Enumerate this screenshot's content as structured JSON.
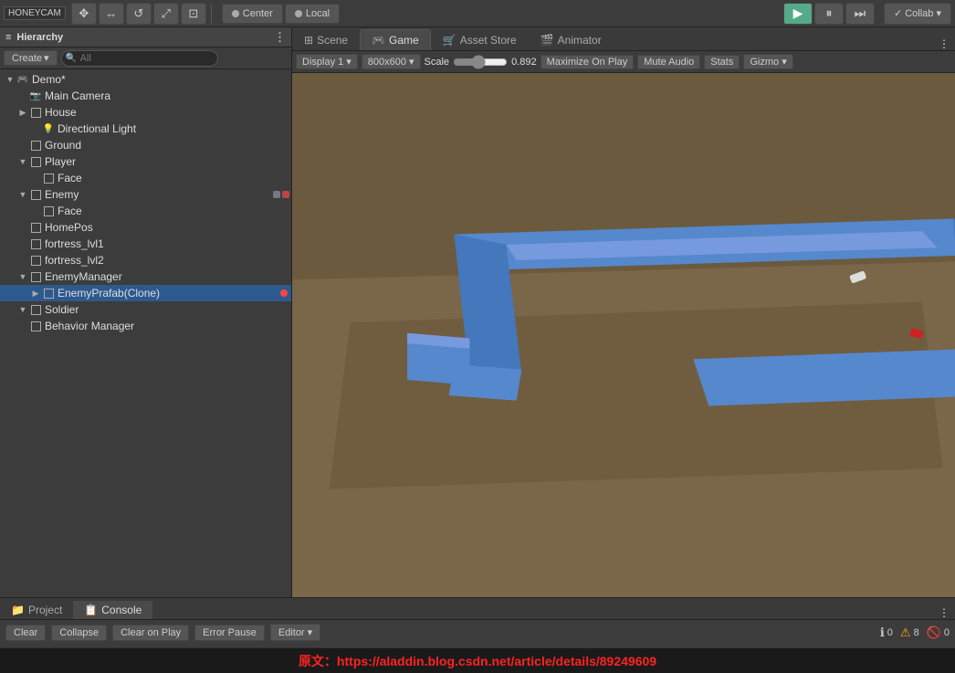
{
  "toolbar": {
    "tools": [
      "✥",
      "↔",
      "↺",
      "⤢",
      "⊡"
    ],
    "pivot": "Center",
    "space": "Local",
    "play": "▶",
    "pause": "⏸",
    "step": "⏭",
    "collab": "✓ Collab ▾"
  },
  "hierarchy": {
    "title": "Hierarchy",
    "create_label": "Create",
    "search_placeholder": "All",
    "items": [
      {
        "id": "demo",
        "label": "Demo*",
        "indent": 0,
        "arrow": "▼",
        "icon": "root"
      },
      {
        "id": "main-camera",
        "label": "Main Camera",
        "indent": 1,
        "arrow": " ",
        "icon": "camera"
      },
      {
        "id": "house",
        "label": "House",
        "indent": 1,
        "arrow": "▶",
        "icon": "go"
      },
      {
        "id": "directional-light",
        "label": "Directional Light",
        "indent": 2,
        "arrow": " ",
        "icon": "light"
      },
      {
        "id": "ground",
        "label": "Ground",
        "indent": 1,
        "arrow": " ",
        "icon": "go"
      },
      {
        "id": "player",
        "label": "Player",
        "indent": 1,
        "arrow": "▼",
        "icon": "go"
      },
      {
        "id": "face-player",
        "label": "Face",
        "indent": 2,
        "arrow": " ",
        "icon": "go"
      },
      {
        "id": "enemy",
        "label": "Enemy",
        "indent": 1,
        "arrow": "▼",
        "icon": "go"
      },
      {
        "id": "face-enemy",
        "label": "Face",
        "indent": 2,
        "arrow": " ",
        "icon": "go"
      },
      {
        "id": "homepos",
        "label": "HomePos",
        "indent": 1,
        "arrow": " ",
        "icon": "go"
      },
      {
        "id": "fortress-lvl1",
        "label": "fortress_lvl1",
        "indent": 1,
        "arrow": " ",
        "icon": "go"
      },
      {
        "id": "fortress-lvl2",
        "label": "fortress_lvl2",
        "indent": 1,
        "arrow": " ",
        "icon": "go"
      },
      {
        "id": "enemy-manager",
        "label": "EnemyManager",
        "indent": 1,
        "arrow": "▼",
        "icon": "go"
      },
      {
        "id": "enemy-prafab",
        "label": "EnemyPrafab(Clone)",
        "indent": 2,
        "arrow": "▶",
        "icon": "go",
        "warning": true,
        "selected": true
      },
      {
        "id": "soldier",
        "label": "Soldier",
        "indent": 1,
        "arrow": "▼",
        "icon": "go"
      },
      {
        "id": "behavior-manager",
        "label": "Behavior Manager",
        "indent": 1,
        "arrow": " ",
        "icon": "go"
      }
    ]
  },
  "tabs": [
    {
      "id": "scene",
      "label": "Scene",
      "icon": "⊞",
      "active": false
    },
    {
      "id": "game",
      "label": "Game",
      "icon": "🎮",
      "active": true
    },
    {
      "id": "asset-store",
      "label": "Asset Store",
      "icon": "🛒",
      "active": false
    },
    {
      "id": "animator",
      "label": "Animator",
      "icon": "🎬",
      "active": false
    }
  ],
  "game_toolbar": {
    "display": "Display 1",
    "resolution": "800x600",
    "scale_label": "Scale",
    "scale_value": "0.892",
    "maximize_on_play": "Maximize On Play",
    "mute_audio": "Mute Audio",
    "stats": "Stats",
    "gizmos": "Gizmo"
  },
  "bottom_tabs": [
    {
      "id": "project",
      "label": "Project",
      "icon": "📁",
      "active": false
    },
    {
      "id": "console",
      "label": "Console",
      "icon": "📋",
      "active": true
    }
  ],
  "console_toolbar": {
    "clear": "Clear",
    "collapse": "Collapse",
    "clear_on_play": "Clear on Play",
    "error_pause": "Error Pause",
    "editor": "Editor"
  },
  "console_badges": {
    "info_count": "0",
    "warning_count": "8",
    "error_count": "0"
  },
  "watermark": {
    "text": "原文：https://aladdin.blog.csdn.net/article/details/89249609"
  },
  "honeycam": "HONEYCAM"
}
